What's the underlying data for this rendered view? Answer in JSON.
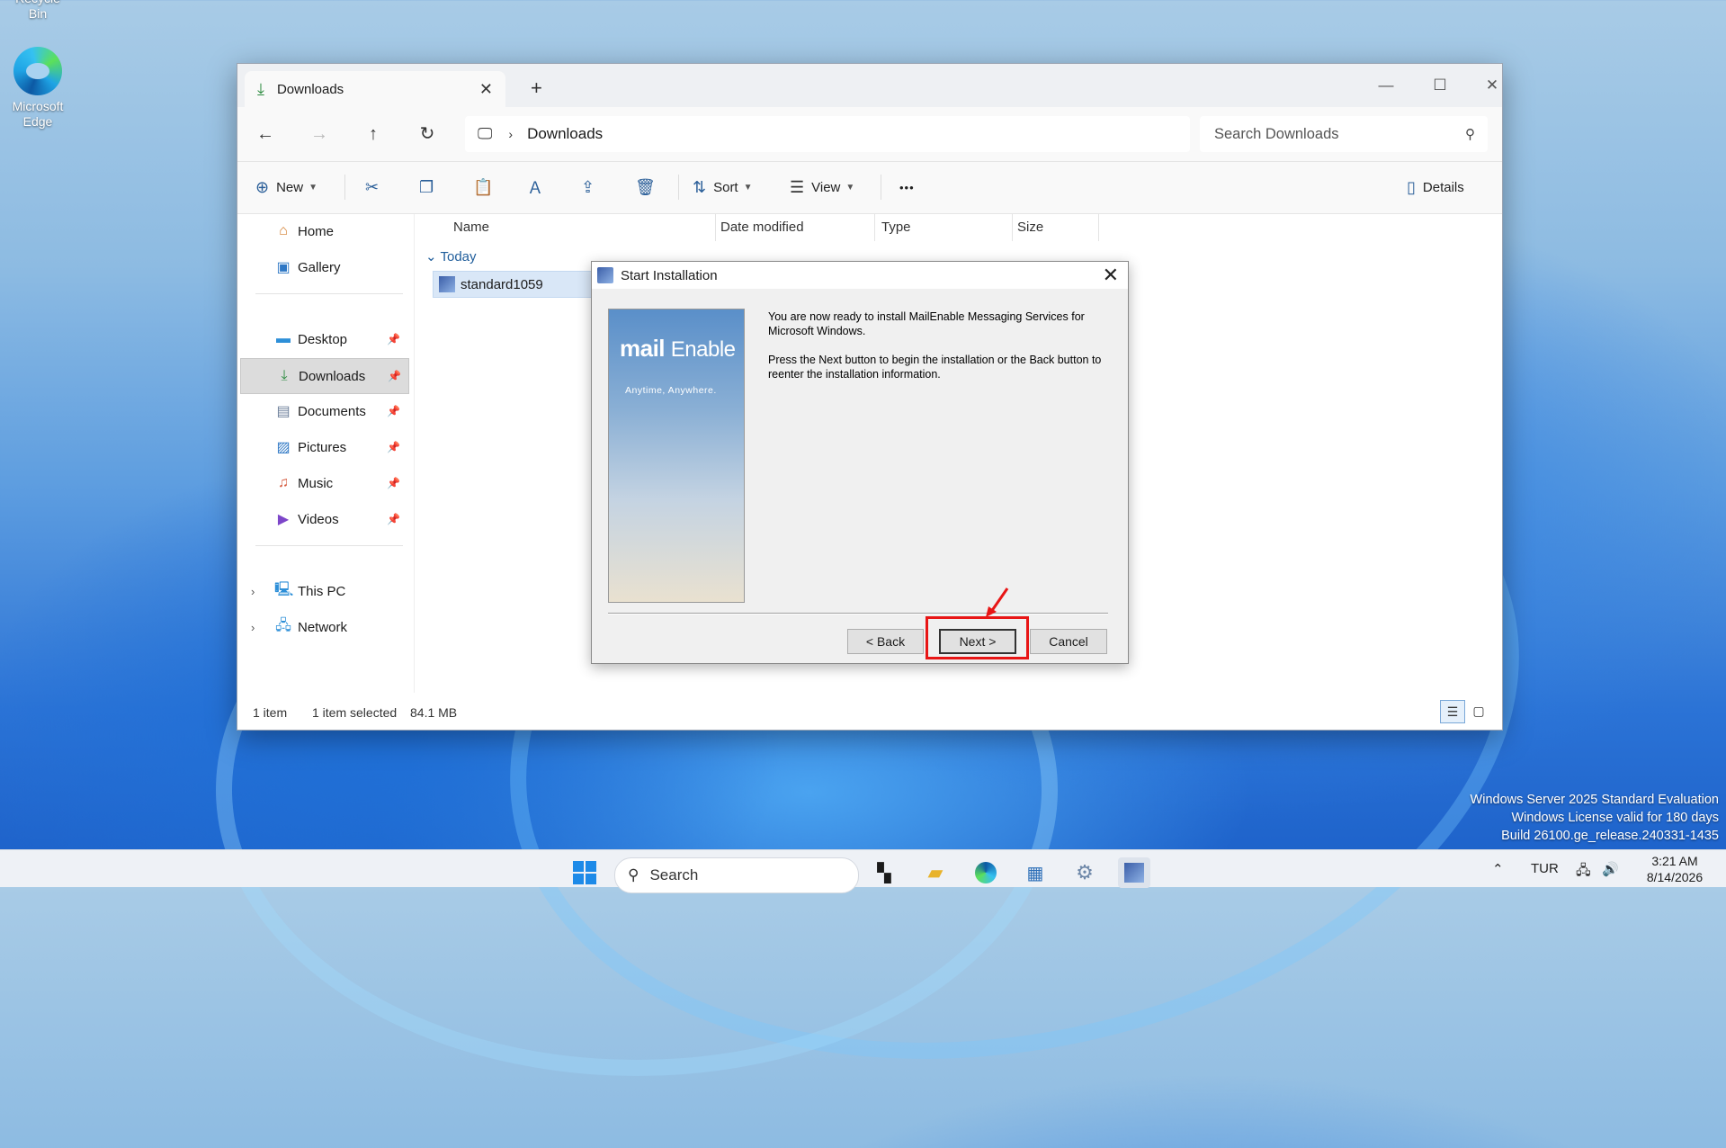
{
  "desktop": {
    "recycle_bin_label": "Recycle Bin",
    "edge_label_line1": "Microsoft",
    "edge_label_line2": "Edge",
    "watermark_line1": "Windows Server 2025 Standard Evaluation",
    "watermark_line2": "Windows License valid for 180 days",
    "watermark_line3": "Build 26100.ge_release.240331-1435"
  },
  "explorer": {
    "tab_label": "Downloads",
    "path_crumb": "Downloads",
    "search_placeholder": "Search Downloads",
    "toolbar": {
      "new_label": "New",
      "sort_label": "Sort",
      "view_label": "View",
      "more_label": "•••",
      "details_label": "Details"
    },
    "sidebar": {
      "home": "Home",
      "gallery": "Gallery",
      "desktop": "Desktop",
      "downloads": "Downloads",
      "documents": "Documents",
      "pictures": "Pictures",
      "music": "Music",
      "videos": "Videos",
      "this_pc": "This PC",
      "network": "Network"
    },
    "columns": {
      "name": "Name",
      "date_modified": "Date modified",
      "type": "Type",
      "size": "Size"
    },
    "group_label": "Today",
    "file_name": "standard1059",
    "status": {
      "item_count": "1 item",
      "selected": "1 item selected",
      "size": "84.1 MB"
    }
  },
  "installer": {
    "title": "Start Installation",
    "logo_mail": "mail",
    "logo_enable": "Enable",
    "logo_tagline": "Anytime, Anywhere.",
    "paragraph1": "You are now ready to install MailEnable Messaging Services for Microsoft Windows.",
    "paragraph2": "Press the Next button to begin the installation or the Back button to reenter the installation information.",
    "back_label": "< Back",
    "next_label": "Next >",
    "cancel_label": "Cancel"
  },
  "taskbar": {
    "search_label": "Search",
    "language": "TUR",
    "time": "3:21 AM",
    "date": "8/14/2026"
  }
}
